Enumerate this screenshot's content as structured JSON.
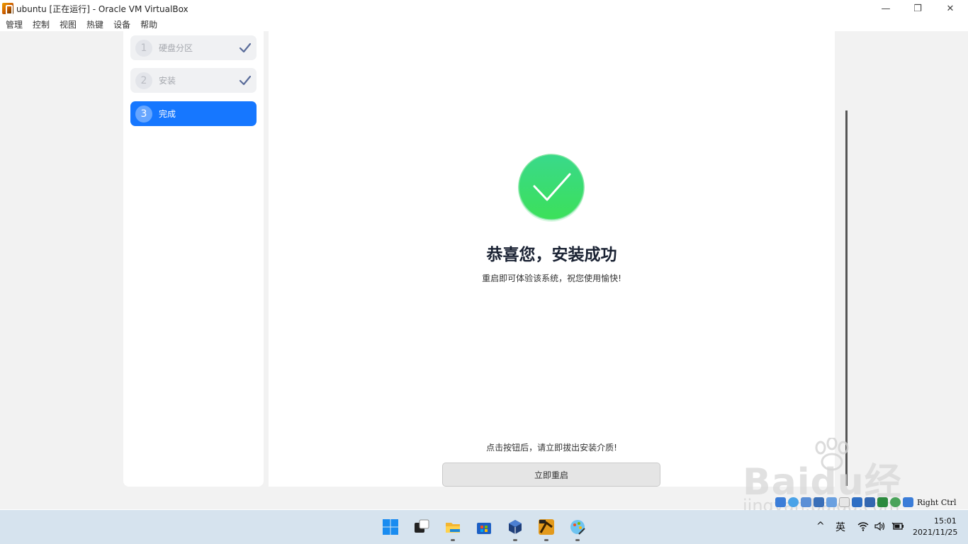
{
  "window": {
    "title": "ubuntu [正在运行] - Oracle VM VirtualBox",
    "minimize_glyph": "—",
    "maximize_glyph": "❐",
    "close_glyph": "✕"
  },
  "menubar": {
    "items": [
      "管理",
      "控制",
      "视图",
      "热键",
      "设备",
      "帮助"
    ]
  },
  "installer": {
    "steps": [
      {
        "number": "1",
        "label": "硬盘分区",
        "state": "done"
      },
      {
        "number": "2",
        "label": "安装",
        "state": "done"
      },
      {
        "number": "3",
        "label": "完成",
        "state": "active"
      }
    ],
    "success_title": "恭喜您，安装成功",
    "success_subtitle": "重启即可体验该系统，祝您使用愉快!",
    "eject_hint": "点击按钮后，请立即拔出安装介质!",
    "restart_button": "立即重启"
  },
  "vbox_status": {
    "host_key": "Right Ctrl",
    "icons": [
      "hard-disk-icon",
      "optical-drive-icon",
      "audio-icon",
      "network-icon",
      "usb-icon",
      "shared-folders-icon",
      "display-icon",
      "video-capture-icon",
      "vm-status-icon",
      "guest-additions-icon",
      "mouse-integration-icon",
      "keyboard-capture-icon"
    ]
  },
  "watermark": {
    "brand": "Baidu经验",
    "url": "jingyan.baidu.com"
  },
  "taskbar": {
    "apps": [
      "windows-start-icon",
      "task-view-icon",
      "file-explorer-icon",
      "microsoft-store-icon",
      "virtualbox-icon",
      "virtualbox-vm-icon",
      "paint-icon"
    ],
    "tray": {
      "chevron": "^",
      "ime": "英"
    },
    "time": "15:01",
    "date": "2021/11/25"
  },
  "colors": {
    "accent": "#1677ff",
    "success_green": "#3ddc6a",
    "taskbar_bg": "#d6e3ee"
  }
}
